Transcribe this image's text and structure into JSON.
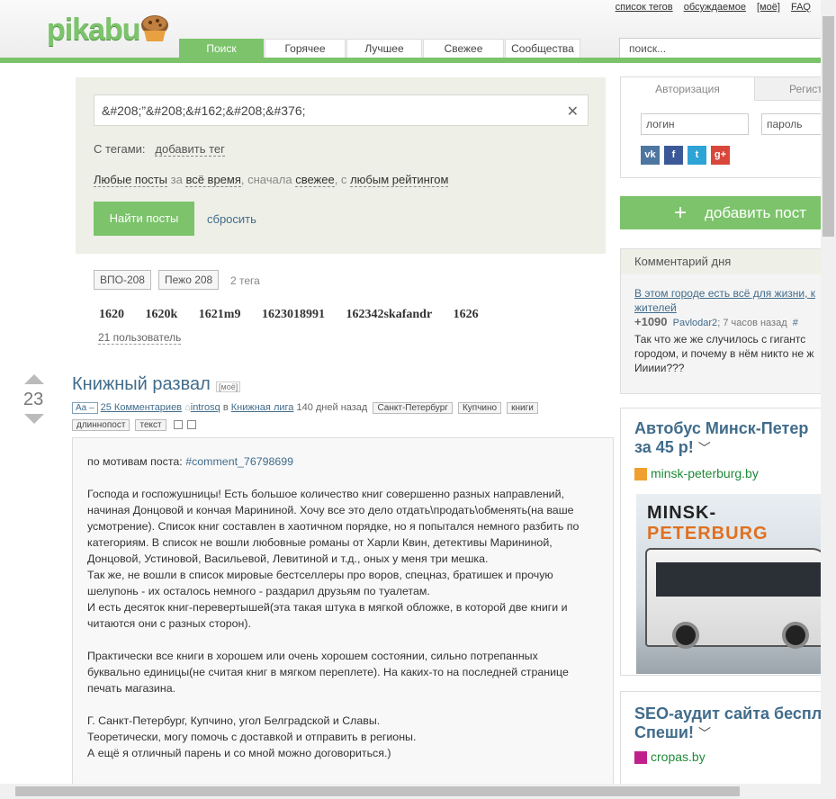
{
  "header": {
    "logo": "pikabu",
    "links": [
      "список тегов",
      "обсуждаемое",
      "[моё]",
      "FAQ"
    ],
    "tabs": [
      "Поиск",
      "Горячее",
      "Лучшее",
      "Свежее",
      "Сообщества"
    ],
    "search_placeholder": "поиск..."
  },
  "search": {
    "query": "&#208;”&#208;&#162;&#208;&#376;",
    "tags_label": "С тегами:",
    "add_tag": "добавить тег",
    "filter": {
      "any_posts": "Любые посты",
      "for": "за",
      "all_time": "всё время",
      "first": ", сначала",
      "fresh": "свежее",
      "with": ", с",
      "any_rating": "любым рейтингом"
    },
    "find_button": "Найти посты",
    "reset": "сбросить"
  },
  "tag_results": {
    "tags": [
      "ВПО-208",
      "Пежо 208"
    ],
    "count": "2 тега"
  },
  "user_results": {
    "users": [
      "1620",
      "1620k",
      "1621m9",
      "1623018991",
      "162342skafandr",
      "1626"
    ],
    "count": "21 пользователь"
  },
  "post": {
    "rating": "23",
    "title": "Книжный развал",
    "mine": "[моё]",
    "aa": "Aa –",
    "comments": "25 Комментариев",
    "author": "introsq",
    "in": "в",
    "community": "Книжная лига",
    "age": "140 дней назад",
    "tags": [
      "Санкт-Петербург",
      "Купчино",
      "книги",
      "длиннопост",
      "текст"
    ],
    "body_prefix": "по мотивам поста: ",
    "body_link": "#comment_76798699",
    "body": "\n\nГоспода и госпожушницы! Есть большое количество книг совершенно разных направлений,\nначиная Донцовой и кончая Марининой. Хочу все это дело отдать\\продать\\обменять(на ваше\nусмотрение). Список книг составлен в хаотичном порядке, но я попытался немного разбить по\nкатегориям. В список не вошли любовные романы от Харли Квин, детективы Марининой,\nДонцовой, Устиновой, Васильевой, Левитиной и т.д., оных у меня три мешка.\nТак же, не вошли в список мировые бестселлеры про воров, спецназ, братишек и прочую\nшелупонь - их осталось немного - раздарил друзьям по туалетам.\nИ есть десяток книг-перевертышей(эта такая штука в мягкой обложке, в которой две книги и\nчитаются они с разных сторон).\n\nПрактически все книги в хорошем или очень хорошем состоянии, сильно потрепанных\nбуквально единицы(не считая книг в мягком переплете). На каких-то на последней странице\nпечать магазина.\n\nГ. Санкт-Петербург, Купчино, угол Белградской и Славы.\nТеоретически, могу помочь с доставкой и отправить в регионы.\nА ещё я отличный парень и со мной можно договориться.)"
  },
  "auth": {
    "tab_login": "Авторизация",
    "tab_register": "Регистрация",
    "login_placeholder": "логин",
    "password_placeholder": "пароль",
    "social": [
      "vk-icon",
      "facebook-icon",
      "twitter-icon",
      "google-plus-icon"
    ]
  },
  "add_post": "добавить пост",
  "comment_of_day": {
    "header": "Комментарий дня",
    "link": "В этом городе есть всё для жизни, к",
    "link2": "жителей",
    "rating": "+1090",
    "user": "Pavlodar2",
    "time": "7 часов назад",
    "hash": "#",
    "text": "Так что же же случилось с гигантс городом, и почему в нём никто не ж Иииии???"
  },
  "ads": [
    {
      "title1": "Автобус Минск-Петер",
      "title2": "за 45 р!",
      "site": "minsk-peterburg.by",
      "image_text1": "MINSK-",
      "image_text2": "PETERBURG"
    },
    {
      "title1": "SEO-аудит сайта беспл",
      "title2": "Спеши!",
      "site": "cropas.by"
    }
  ],
  "colors": {
    "brand_green": "#7cc36b",
    "link_blue": "#416c8b"
  }
}
